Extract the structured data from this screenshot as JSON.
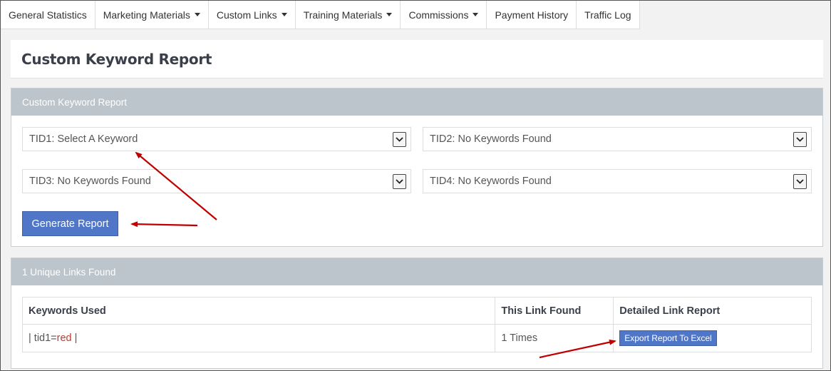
{
  "nav": {
    "tabs": [
      {
        "label": "General Statistics",
        "dropdown": false
      },
      {
        "label": "Marketing Materials",
        "dropdown": true
      },
      {
        "label": "Custom Links",
        "dropdown": true
      },
      {
        "label": "Training Materials",
        "dropdown": true
      },
      {
        "label": "Commissions",
        "dropdown": true
      },
      {
        "label": "Payment History",
        "dropdown": false
      },
      {
        "label": "Traffic Log",
        "dropdown": false
      }
    ]
  },
  "page": {
    "title": "Custom Keyword Report"
  },
  "filters": {
    "heading": "Custom Keyword Report",
    "tid1": "TID1: Select A Keyword",
    "tid2": "TID2: No Keywords Found",
    "tid3": "TID3: No Keywords Found",
    "tid4": "TID4: No Keywords Found",
    "generate_label": "Generate Report"
  },
  "results": {
    "heading": "1 Unique Links Found",
    "columns": [
      "Keywords Used",
      "This Link Found",
      "Detailed Link Report"
    ],
    "rows": [
      {
        "kw_prefix": "| tid1=",
        "kw_value": "red",
        "kw_suffix": " |",
        "found": "1 Times",
        "action": "Export Report To Excel"
      }
    ]
  },
  "colors": {
    "accent": "#5076c8",
    "panel_header": "#bcc5cc",
    "annotation_arrow": "#c00000",
    "keyword_value": "#c0392b"
  }
}
